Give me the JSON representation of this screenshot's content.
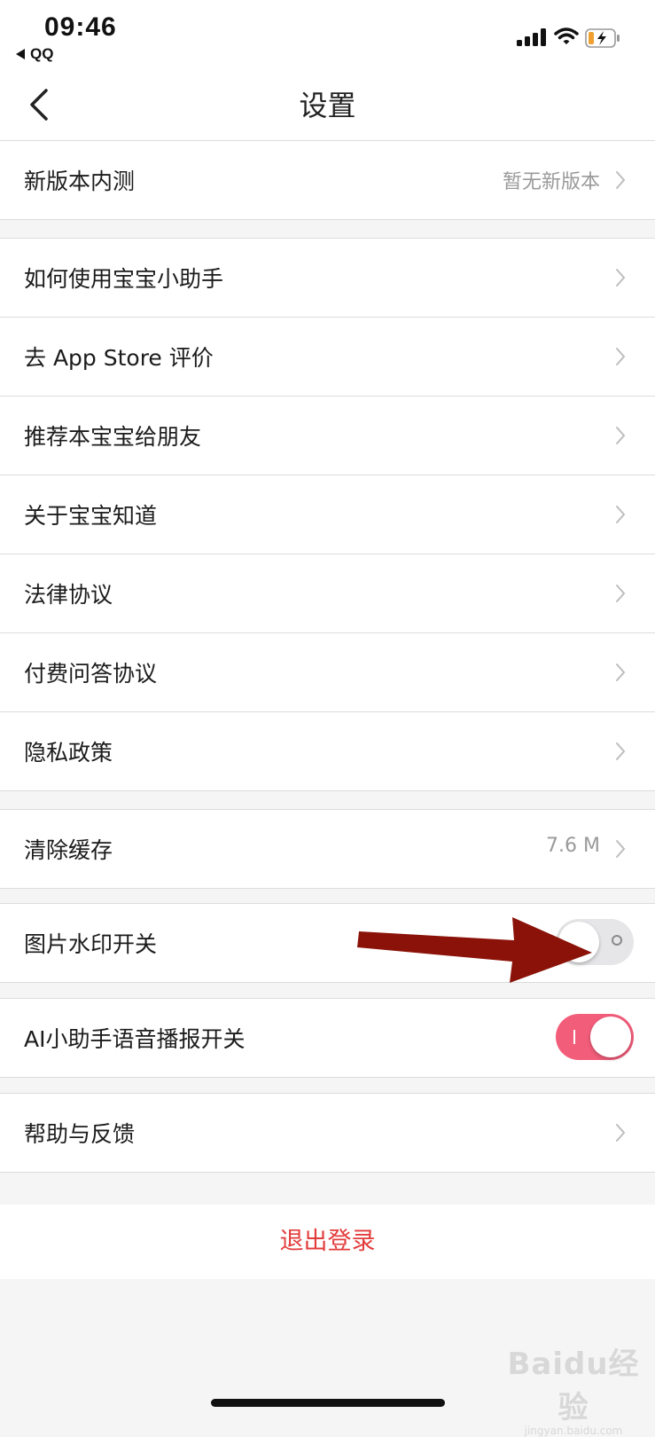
{
  "status_bar": {
    "time": "09:46",
    "back_app": "QQ",
    "icons": [
      "signal-icon",
      "wifi-icon",
      "battery-charging-icon"
    ]
  },
  "header": {
    "title": "设置",
    "back_icon": "chevron-left-icon"
  },
  "groups": {
    "beta": {
      "label": "新版本内测",
      "value": "暂无新版本"
    },
    "info": [
      {
        "label": "如何使用宝宝小助手"
      },
      {
        "label": "去 App Store 评价"
      },
      {
        "label": "推荐本宝宝给朋友"
      },
      {
        "label": "关于宝宝知道"
      },
      {
        "label": "法律协议"
      },
      {
        "label": "付费问答协议"
      },
      {
        "label": "隐私政策"
      }
    ],
    "cache": {
      "label": "清除缓存",
      "value": "7.6 M"
    },
    "watermark_switch": {
      "label": "图片水印开关",
      "state": "off"
    },
    "voice_switch": {
      "label": "AI小助手语音播报开关",
      "state": "on"
    },
    "help": {
      "label": "帮助与反馈"
    }
  },
  "logout": {
    "label": "退出登录"
  },
  "colors": {
    "accent_toggle_on": "#f25d7a",
    "logout_text": "#e33c3c",
    "annotation_arrow": "#8b1208",
    "background": "#f5f5f6"
  },
  "watermark": {
    "text": "Baidu经验",
    "sub": "jingyan.baidu.com"
  }
}
